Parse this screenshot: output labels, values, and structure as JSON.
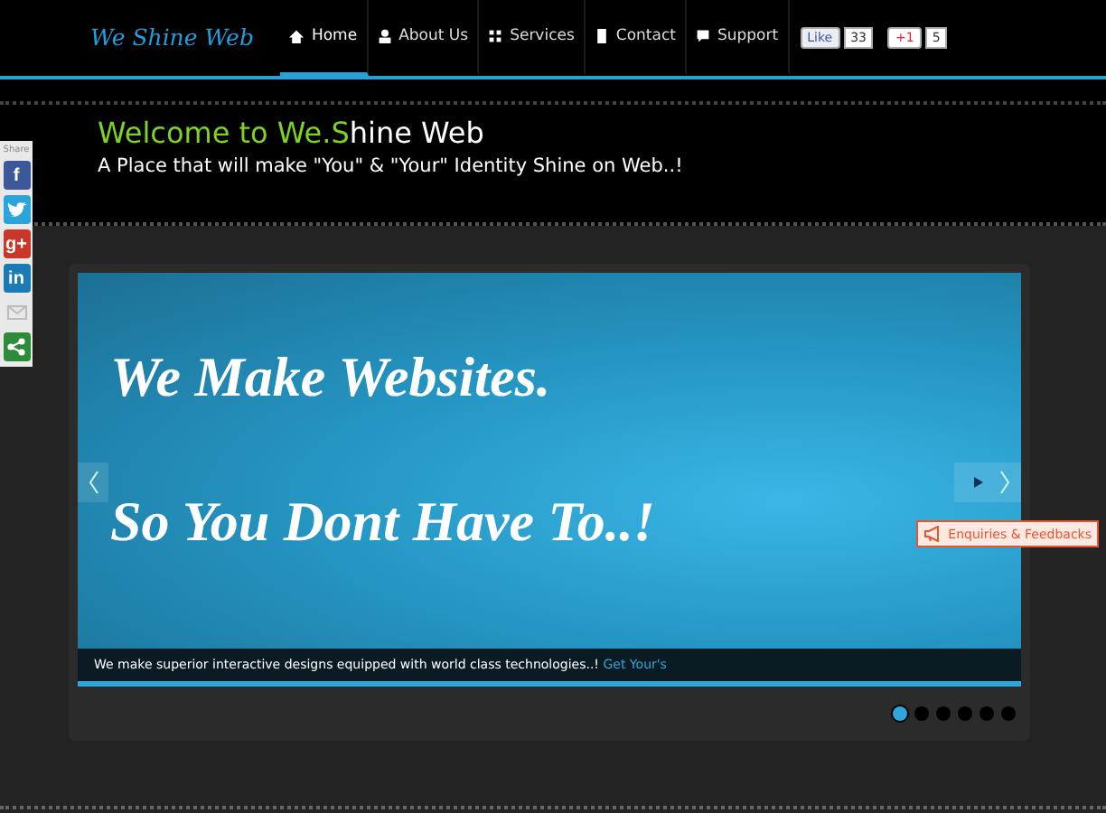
{
  "brand": {
    "logo": "We Shine Web"
  },
  "nav": [
    {
      "label": "Home",
      "selected": true
    },
    {
      "label": "About Us",
      "selected": false
    },
    {
      "label": "Services",
      "selected": false
    },
    {
      "label": "Contact",
      "selected": false
    },
    {
      "label": "Support",
      "selected": false
    }
  ],
  "social": [
    {
      "kind": "like",
      "label": "Like",
      "count": "33"
    },
    {
      "kind": "plusone",
      "label": "+1",
      "count": "5"
    }
  ],
  "welcome": {
    "title_highlight": "Welcome to We.S",
    "title_rest": "hine Web",
    "tagline": "A Place that will make \"You\" & \"Your\" Identity Shine on Web..!"
  },
  "share_bar": {
    "label": "Share",
    "buttons": [
      {
        "kind": "facebook",
        "glyph": "f",
        "color": "#3b5998"
      },
      {
        "kind": "twitter",
        "color": "#2aa4dc"
      },
      {
        "kind": "googleplus",
        "glyph": "g+",
        "color": "#c9372a"
      },
      {
        "kind": "linkedin",
        "glyph": "in",
        "color": "#1c7bb4"
      },
      {
        "kind": "email",
        "color": "#e8e8e8"
      },
      {
        "kind": "share",
        "color": "#2e8b3a"
      }
    ]
  },
  "slider": {
    "headlines": [
      "We Make Websites.",
      "So You Dont Have To..!"
    ],
    "caption": "We make superior interactive designs equipped with world class technologies..!",
    "caption_link": "Get Your's",
    "dots": [
      {
        "selected": true
      },
      {
        "selected": false
      },
      {
        "selected": false
      },
      {
        "selected": false
      },
      {
        "selected": false
      },
      {
        "selected": false
      }
    ]
  },
  "enquiry_button": {
    "label": "Enquiries & Feedbacks"
  }
}
